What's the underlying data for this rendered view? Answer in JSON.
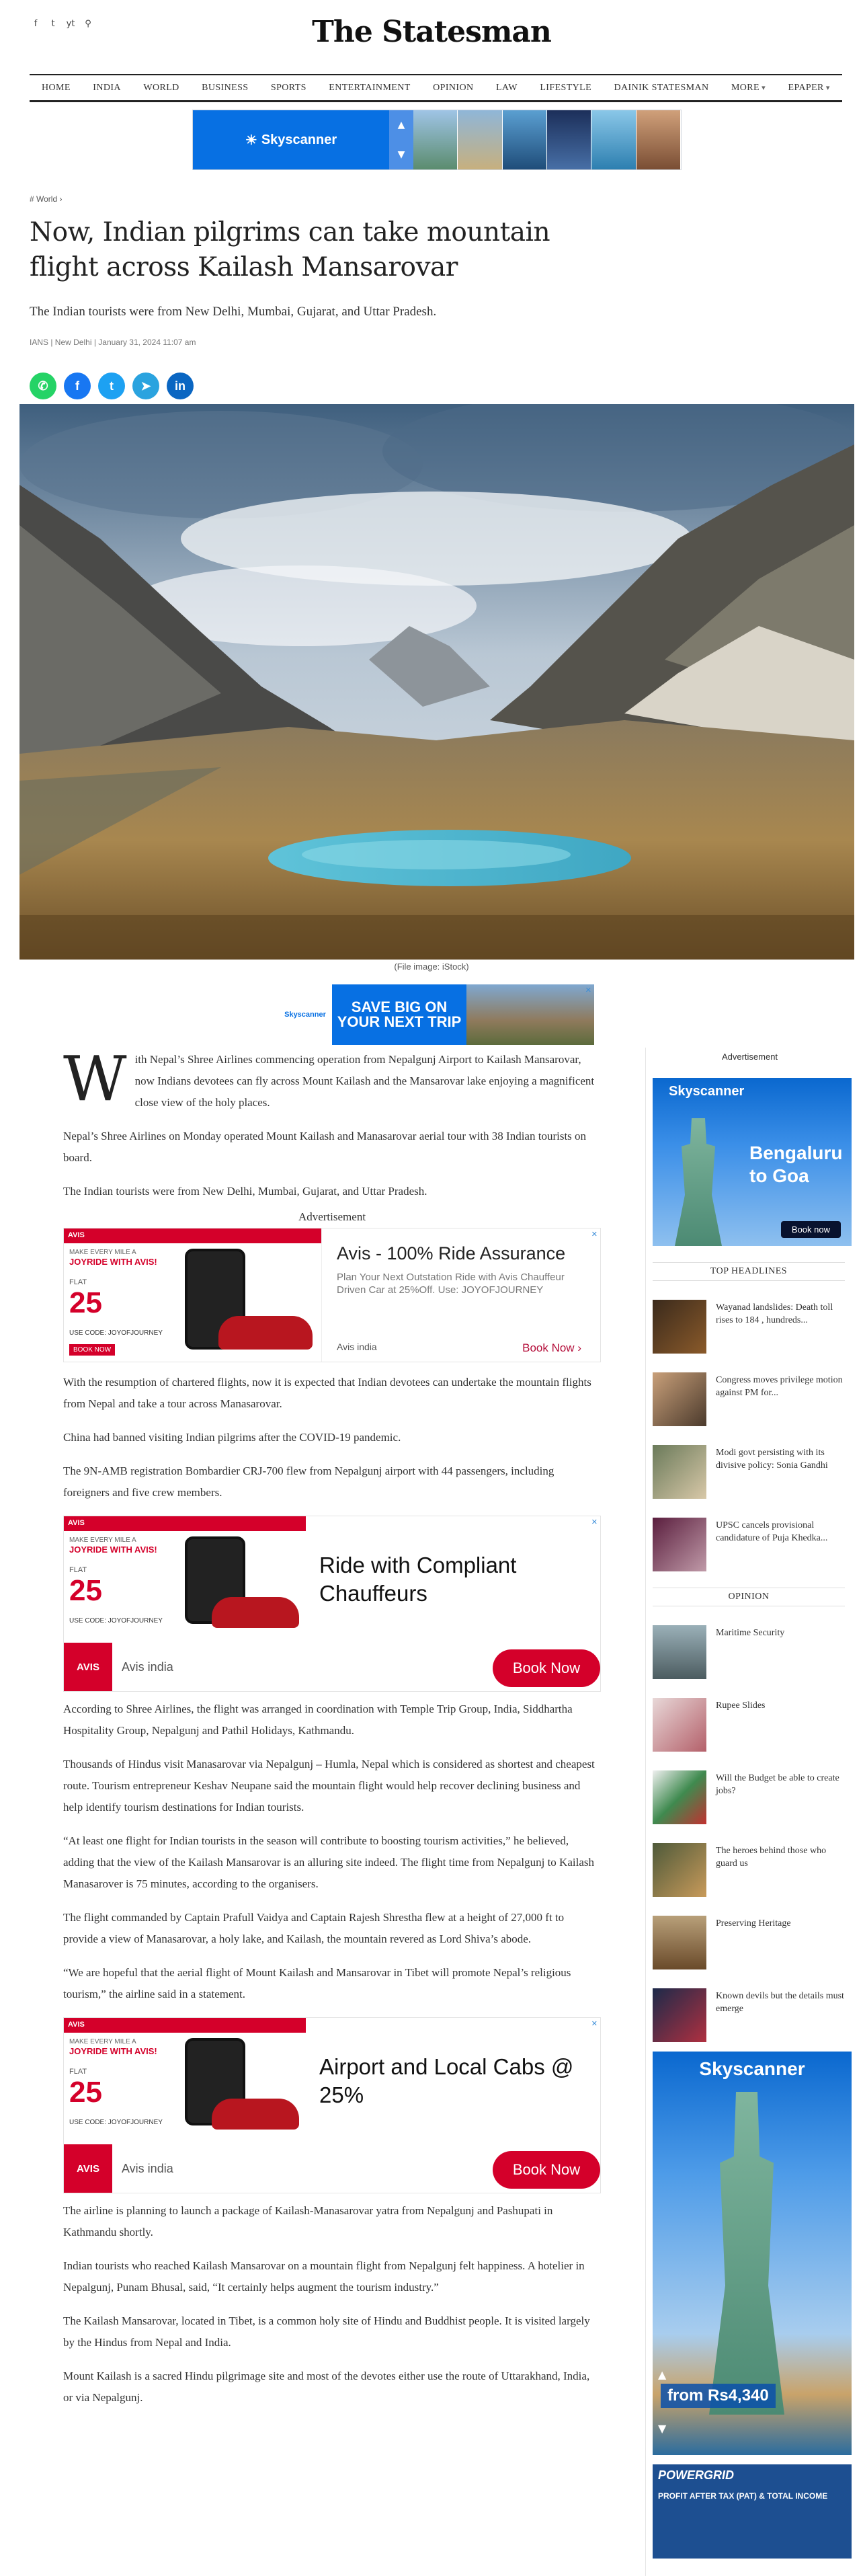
{
  "header": {
    "logo": "The Statesman",
    "social": [
      "f",
      "t",
      "yt",
      "⚲"
    ]
  },
  "nav": {
    "items": [
      "HOME",
      "INDIA",
      "WORLD",
      "BUSINESS",
      "SPORTS",
      "ENTERTAINMENT",
      "OPINION",
      "LAW",
      "LIFESTYLE",
      "DAINIK STATESMAN",
      "MORE",
      "EPAPER"
    ]
  },
  "ads": {
    "top_brand": "Skyscanner",
    "mid_brand": "Skyscanner",
    "mid_text": "SAVE BIG ON YOUR NEXT TRIP",
    "label": "Advertisement",
    "avis1": {
      "bar": "AVIS",
      "make": "MAKE EVERY MILE A",
      "joy": "JOYRIDE WITH AVIS!",
      "flat": "FLAT",
      "pct": "25",
      "code": "USE CODE: JOYOFJOURNEY",
      "book_small": "BOOK NOW",
      "title": "Avis - 100% Ride Assurance",
      "desc": "Plan Your Next Outstation Ride with Avis Chauffeur Driven Car at 25%Off. Use: JOYOFJOURNEY",
      "brand": "Avis india",
      "cta": "Book Now"
    },
    "avis2": {
      "title": "Ride with Compliant Chauffeurs",
      "logo": "AVIS",
      "brand": "Avis india",
      "cta": "Book Now"
    },
    "avis3": {
      "title": "Airport and Local Cabs @ 25%",
      "logo": "AVIS",
      "brand": "Avis india",
      "cta": "Book Now"
    },
    "sidebar1": {
      "brand": "Skyscanner",
      "promo": "Bengaluru to Goa",
      "cta": "Book now"
    },
    "sidebar2": {
      "brand": "Skyscanner",
      "price": "from Rs4,340"
    },
    "sidebar3": {
      "brand": "POWERGRID",
      "text": "PROFIT AFTER TAX (PAT) & TOTAL INCOME"
    }
  },
  "article": {
    "breadcrumb": "# World ›",
    "headline": "Now, Indian pilgrims can take mountain flight across Kailash Mansarovar",
    "summary": "The Indian tourists were from New Delhi, Mumbai, Gujarat, and Uttar Pradesh.",
    "byline": "IANS | New Delhi | January 31, 2024 11:07 am",
    "caption": "(File image: iStock)",
    "dropcap": "W",
    "p1": "ith Nepal’s Shree Airlines commencing operation from Nepalgunj Airport to Kailash Mansarovar, now Indians devotees can fly across Mount Kailash and the Mansarovar lake enjoying a magnificent close view of the holy places.",
    "p2": "Nepal’s Shree Airlines on Monday operated Mount Kailash and Manasarovar aerial tour with 38 Indian tourists on board.",
    "p3": "The Indian tourists were from New Delhi, Mumbai, Gujarat, and Uttar Pradesh.",
    "p4": "With the resumption of chartered flights, now it is expected that Indian devotees can undertake the mountain flights from Nepal and take a tour across Manasarovar.",
    "p5": "China had banned visiting Indian pilgrims after the COVID-19 pandemic.",
    "p6": "The 9N-AMB registration Bombardier CRJ-700 flew from Nepalgunj airport with 44 passengers, including foreigners and five crew members.",
    "p7": "According to Shree Airlines, the flight was arranged in coordination with Temple Trip Group, India, Siddhartha Hospitality Group, Nepalgunj and Pathil Holidays, Kathmandu.",
    "p8": "Thousands of Hindus visit Manasarovar via Nepalgunj – Humla, Nepal which is considered as shortest and cheapest route. Tourism entrepreneur Keshav Neupane said the mountain flight would help recover declining business and help identify tourism destinations for Indian tourists.",
    "p9": "“At least one flight for Indian tourists in the season will contribute to boosting tourism activities,” he believed, adding that the view of the Kailash Mansarovar is an alluring site indeed. The flight time from Nepalgunj to Kailash Manasarover is 75 minutes, according to the organisers.",
    "p10": "The flight commanded by Captain Prafull Vaidya and Captain Rajesh Shrestha flew at a height of 27,000 ft to provide a view of Manasarovar, a holy lake, and Kailash, the mountain revered as Lord Shiva’s abode.",
    "p11": "“We are hopeful that the aerial flight of Mount Kailash and Mansarovar in Tibet will promote Nepal’s religious tourism,” the airline said in a statement.",
    "p12": "The airline is planning to launch a package of Kailash-Manasarovar yatra from Nepalgunj and Pashupati in Kathmandu shortly.",
    "p13": "Indian tourists who reached Kailash Mansarovar on a mountain flight from Nepalgunj felt happiness. A hotelier in Nepalgunj, Punam Bhusal, said, “It certainly helps augment the tourism industry.”",
    "p14": "The Kailash Mansarovar, located in Tibet, is a common holy site of Hindu and Buddhist people. It is visited largely by the Hindus from Nepal and India.",
    "p15": "Mount Kailash is a sacred Hindu pilgrimage site and most of the devotes either use the route of Uttarakhand, India, or via Nepalgunj."
  },
  "sidebar": {
    "top_headlines_title": "TOP HEADLINES",
    "top_headlines": [
      "Wayanad landslides: Death toll rises to 184 , hundreds...",
      "Congress moves privilege motion against PM for...",
      "Modi govt persisting with its divisive policy: Sonia Gandhi",
      "UPSC cancels provisional candidature of Puja Khedka..."
    ],
    "opinion_title": "OPINION",
    "opinion": [
      "Maritime Security",
      "Rupee Slides",
      "Will the Budget be able to create jobs?",
      "The heroes behind those who guard us",
      "Preserving Heritage",
      "Known devils but the details must emerge"
    ]
  },
  "colors": {
    "skyscanner": "#0770e3",
    "avis_red": "#d4002a",
    "whatsapp": "#25d366",
    "facebook": "#1877f2",
    "twitter": "#1da1f2",
    "telegram": "#2aa3df",
    "linkedin": "#0a66c2"
  }
}
